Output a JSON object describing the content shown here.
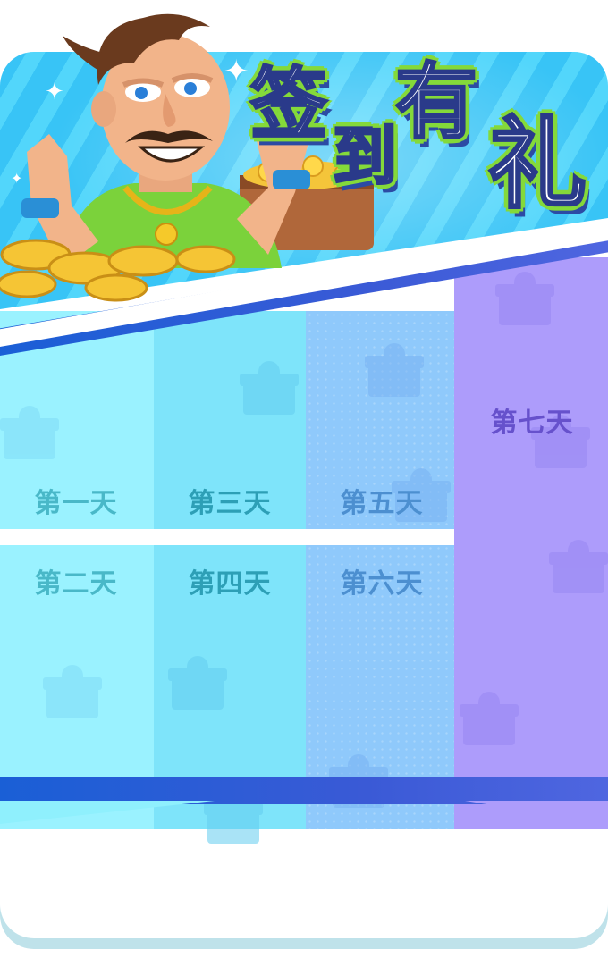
{
  "banner": {
    "title_chars": [
      "签",
      "到",
      "有",
      "礼"
    ]
  },
  "days": [
    {
      "label": "第一天"
    },
    {
      "label": "第二天"
    },
    {
      "label": "第三天"
    },
    {
      "label": "第四天"
    },
    {
      "label": "第五天"
    },
    {
      "label": "第六天"
    },
    {
      "label": "第七天"
    }
  ],
  "colors": {
    "day1_2": "#9af2ff",
    "day3_4": "#7ee4fa",
    "day5_6": "#8fc9fb",
    "day7": "#ad9cfb",
    "banner": "#38c4f6",
    "band": "#1a5fd6",
    "title_outline": "#84d93a"
  },
  "icons": [
    "gift-icon",
    "sparkle-icon",
    "coin-icon",
    "character-illustration"
  ]
}
